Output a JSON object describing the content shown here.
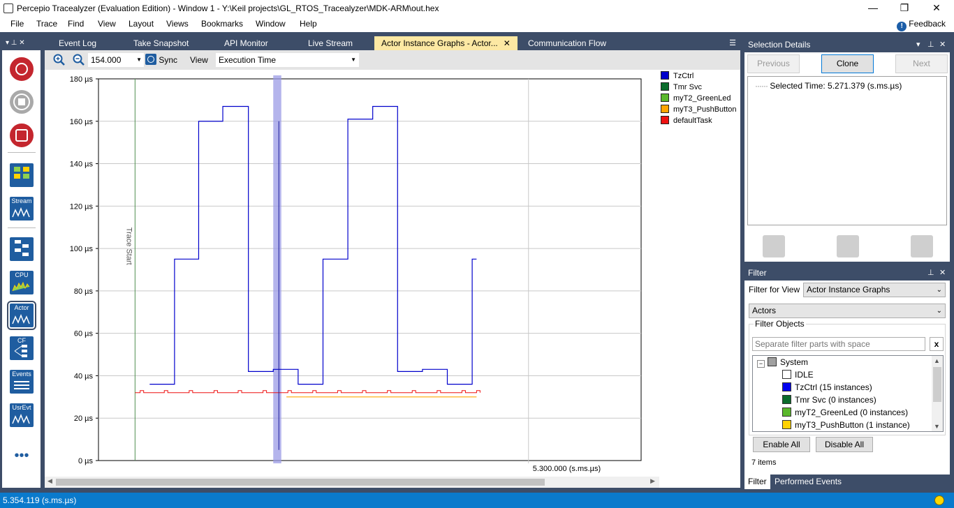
{
  "window": {
    "title": "Percepio Tracealyzer (Evaluation Edition) - Window 1 - Y:\\Keil projects\\GL_RTOS_Tracealyzer\\MDK-ARM\\out.hex",
    "minimize": "—",
    "maximize": "❐",
    "close": "✕"
  },
  "menu": {
    "items": [
      "File",
      "Trace",
      "Find",
      "View",
      "Layout",
      "Views",
      "Bookmarks",
      "Window",
      "Help"
    ],
    "feedback": "Feedback"
  },
  "toolbox": {
    "tiles": [
      "Stream",
      "CPU",
      "Actor",
      "CF",
      "Events",
      "UsrEvt"
    ],
    "more": "•••"
  },
  "tabs": [
    {
      "label": "Event Log",
      "active": false
    },
    {
      "label": "Take Snapshot",
      "active": false
    },
    {
      "label": "API Monitor",
      "active": false
    },
    {
      "label": "Live Stream",
      "active": false
    },
    {
      "label": "Actor Instance Graphs - Actor...",
      "active": true
    },
    {
      "label": "Communication Flow",
      "active": false
    }
  ],
  "graph_toolbar": {
    "zoom_value": "154.000",
    "sync_label": "Sync",
    "view_label": "View",
    "view_select": "Execution Time"
  },
  "chart_data": {
    "type": "line",
    "title": "",
    "xlabel": "",
    "ylabel": "",
    "y_unit": "µs",
    "ylim": [
      0,
      180
    ],
    "yticks": [
      "0 µs",
      "20 µs",
      "40 µs",
      "60 µs",
      "80 µs",
      "100 µs",
      "120 µs",
      "140 µs",
      "160 µs",
      "180 µs"
    ],
    "x_range": [
      5.2412,
      5.3154
    ],
    "x_tick_label": "5.300.000 (s.ms.µs)",
    "x_tick_value": 5.3,
    "grid": true,
    "legend_position": "right",
    "annotations": [
      {
        "text": "Trace Start",
        "x": 5.2462,
        "color": "#4f8f4f"
      },
      {
        "type": "selection",
        "x_from": 5.2651,
        "x_to": 5.2662
      }
    ],
    "series": [
      {
        "name": "TzCtrl",
        "color": "#0000cc",
        "step": true,
        "points": [
          [
            5.2482,
            36
          ],
          [
            5.2516,
            95
          ],
          [
            5.2549,
            160
          ],
          [
            5.2582,
            167
          ],
          [
            5.2617,
            42
          ],
          [
            5.2651,
            43
          ],
          [
            5.2685,
            36
          ],
          [
            5.2719,
            95
          ],
          [
            5.2753,
            161
          ],
          [
            5.2787,
            167
          ],
          [
            5.2821,
            42
          ],
          [
            5.2855,
            43
          ],
          [
            5.2889,
            36
          ],
          [
            5.2923,
            95
          ],
          [
            5.2929,
            95
          ]
        ]
      },
      {
        "name": "Tmr Svc",
        "color": "#0a6b2b",
        "points": []
      },
      {
        "name": "myT2_GreenLed",
        "color": "#5ab82c",
        "points": []
      },
      {
        "name": "myT3_PushButton",
        "color": "#ffa500",
        "points": [
          [
            5.2669,
            30
          ],
          [
            5.2929,
            30
          ]
        ]
      },
      {
        "name": "defaultTask",
        "color": "#ee1111",
        "baseline": 32,
        "spike": 33,
        "spike_x": [
          5.2469,
          5.2502,
          5.2536,
          5.257,
          5.2603,
          5.2637,
          5.2671,
          5.2705,
          5.2739,
          5.2773,
          5.2807,
          5.2841,
          5.2875,
          5.2909,
          5.2929
        ]
      }
    ]
  },
  "selection_details": {
    "title": "Selection Details",
    "buttons": {
      "previous": "Previous",
      "clone": "Clone",
      "next": "Next"
    },
    "selected_time": "Selected Time: 5.271.379 (s.ms.µs)"
  },
  "filter": {
    "title": "Filter",
    "filter_for_view_label": "Filter for View",
    "filter_for_view_value": "Actor Instance Graphs",
    "kind_value": "Actors",
    "filter_objects_label": "Filter Objects",
    "search_placeholder": "Separate filter parts with space",
    "clear": "x",
    "root": {
      "label": "System",
      "color": "#a0a0a0"
    },
    "objects": [
      {
        "label": "IDLE",
        "color": "#ffffff"
      },
      {
        "label": "TzCtrl (15 instances)",
        "color": "#0000ee"
      },
      {
        "label": "Tmr Svc (0 instances)",
        "color": "#0a6b2b"
      },
      {
        "label": "myT2_GreenLed (0 instances)",
        "color": "#5ab82c"
      },
      {
        "label": "myT3_PushButton (1 instance)",
        "color": "#ffd200"
      }
    ],
    "enable_all": "Enable All",
    "disable_all": "Disable All",
    "count": "7 items"
  },
  "bottom_tabs": [
    "Filter",
    "Performed Events"
  ],
  "status": {
    "time": "5.354.119 (s.ms.µs)"
  }
}
